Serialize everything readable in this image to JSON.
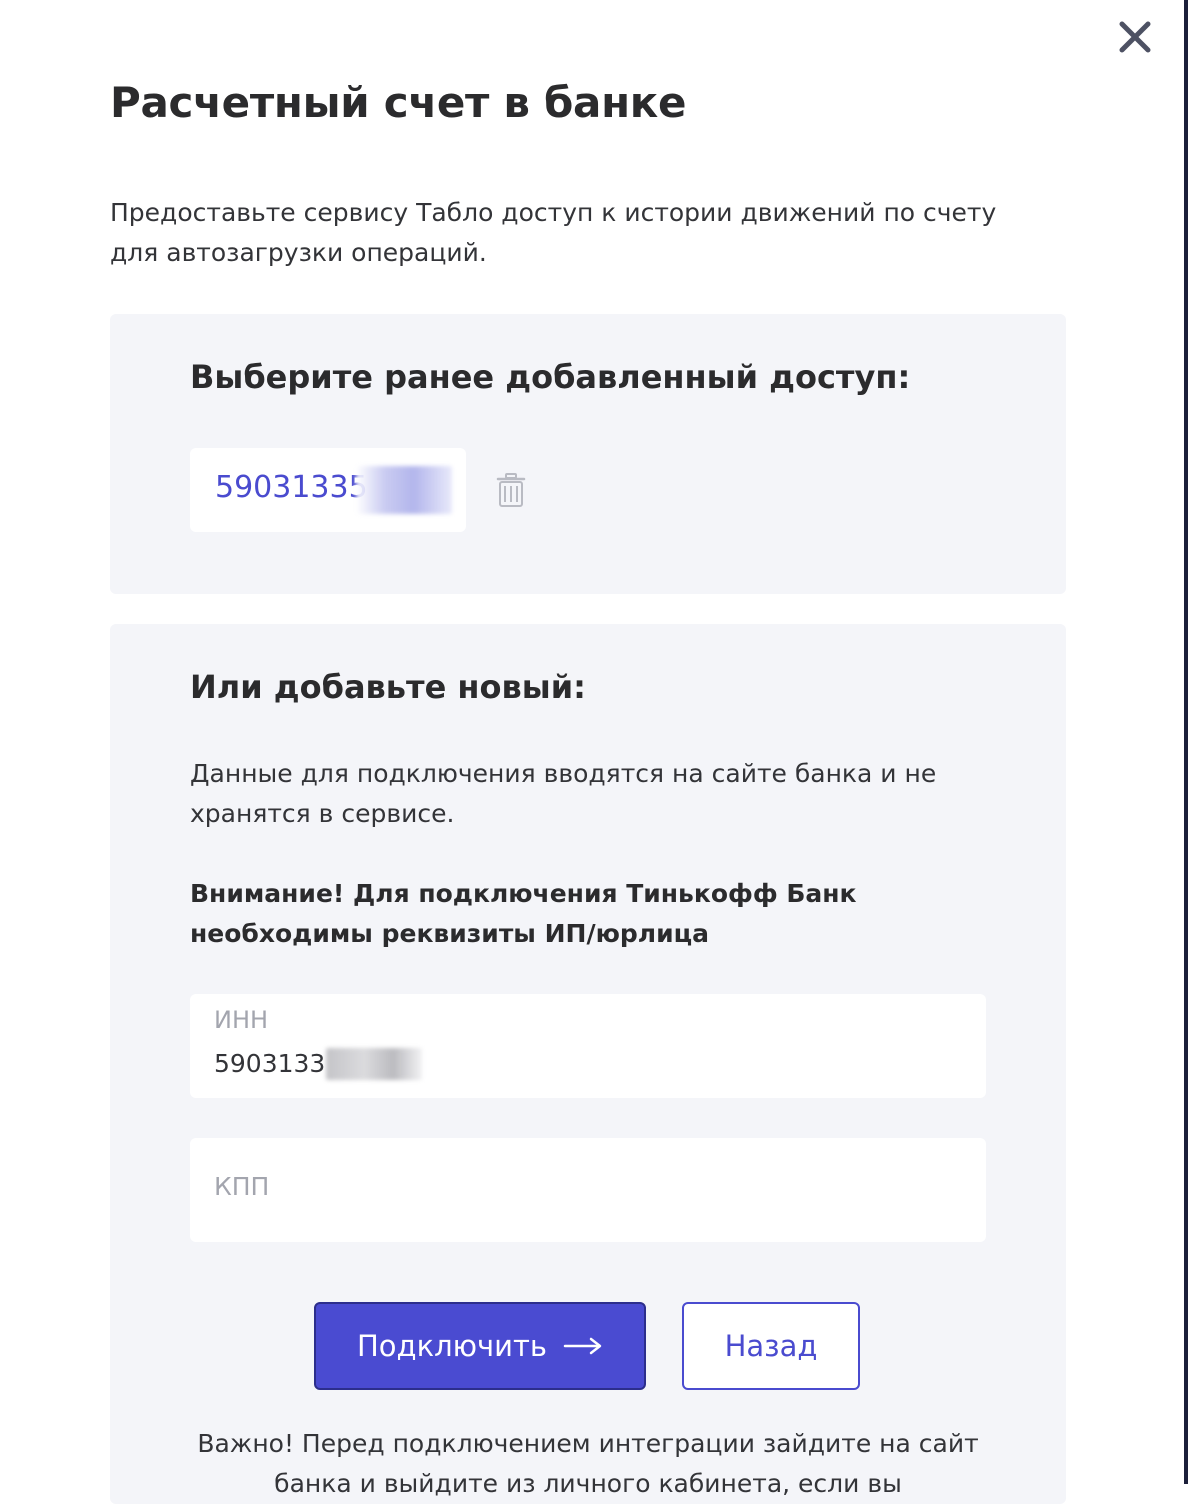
{
  "modal": {
    "title": "Расчетный счет в банке",
    "intro": "Предоставьте сервису Табло доступ к истории движений по счету для автозагрузки операций.",
    "close_icon": "close-icon"
  },
  "existing_access": {
    "heading": "Выберите ранее добавленный доступ:",
    "items": [
      {
        "value": "59031335",
        "delete_icon": "trash-icon"
      }
    ]
  },
  "new_access": {
    "heading": "Или добавьте новый:",
    "description": "Данные для подключения вводятся на сайте банка и не хранятся в сервисе.",
    "warning": "Внимание! Для подключения Тинькофф Банк необходимы реквизиты ИП/юрлица",
    "inn": {
      "label": "ИНН",
      "value": "5903133"
    },
    "kpp": {
      "placeholder": "КПП",
      "value": ""
    },
    "connect_button": "Подключить",
    "connect_icon": "arrow-right-icon",
    "back_button": "Назад",
    "note": "Важно! Перед подключением интеграции зайдите на сайт банка и выйдите из личного кабинета, если вы"
  },
  "colors": {
    "accent": "#4a4bd1",
    "link": "#4a4bcf",
    "card_bg": "#f4f5f9",
    "text": "#2b2b2d"
  }
}
